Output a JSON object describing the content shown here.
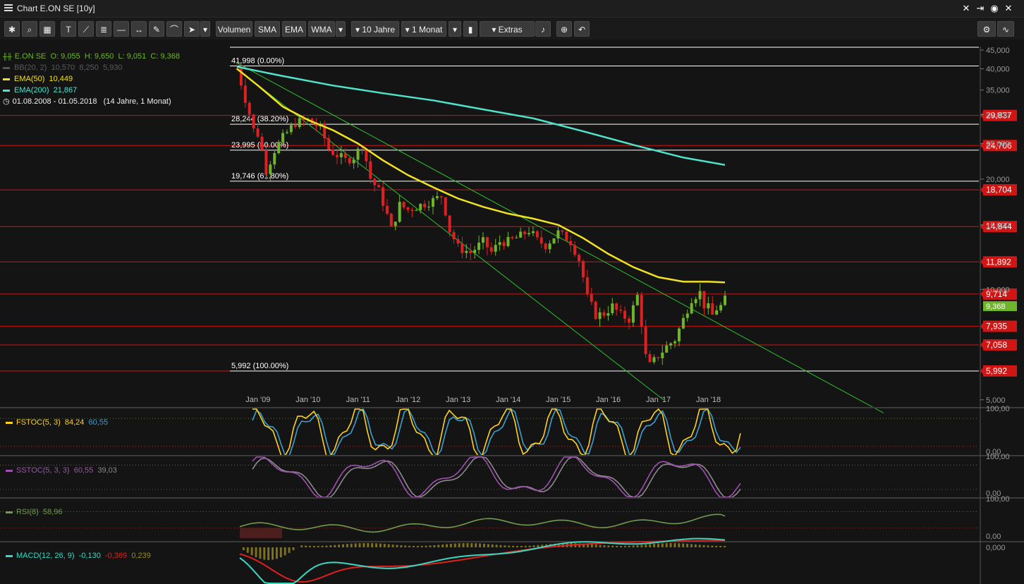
{
  "window": {
    "title": "Chart E.ON SE [10y]"
  },
  "toolbar": {
    "volumen": "Volumen",
    "sma": "SMA",
    "ema": "EMA",
    "wma": "WMA",
    "period": "10 Jahre",
    "interval": "1 Monat",
    "extras": "Extras",
    "icons": [
      "settings-icon",
      "search-icon",
      "grid-icon",
      "text-tool-icon",
      "line-tool-icon",
      "fib-tool-icon",
      "horizontal-line-icon",
      "channel-icon",
      "pen-icon",
      "arc-icon",
      "cursor-icon",
      "zoom-icon",
      "undo-icon",
      "candle-icon",
      "alarm-icon",
      "indicators-icon",
      "wave-icon"
    ]
  },
  "legend": {
    "instrument": "E.ON SE",
    "ohlc": "O: 9,055  H: 9,650  L: 9,051  C: 9,368",
    "bb": "BB(20, 2)  10,570  8,250  5,930",
    "ema50": "EMA(50)  10,449",
    "ema200": "EMA(200)  21,867",
    "range": "01.08.2008 - 01.05.2018   (14 Jahre, 1 Monat)"
  },
  "colors": {
    "bg": "#141414",
    "up": "#6fb52b",
    "down": "#e02020",
    "ema50": "#f1e222",
    "ema200": "#4fe3cc",
    "support": "#d01515",
    "channel": "#2fbf2f",
    "fib": "#ffffff",
    "fstoc_k": "#ffd21e",
    "fstoc_d": "#3aa0d0",
    "sstoc_k": "#a050b0",
    "sstoc_d": "#8a8a8a",
    "rsi": "#6f9b4a",
    "macd": "#3ed6c0",
    "signal": "#e02020"
  },
  "chart_data": [
    {
      "type": "candlestick",
      "title": "Chart E.ON SE [10y]",
      "x_labels": [
        "Jan '09",
        "Jan '10",
        "Jan '11",
        "Jan '12",
        "Jan '13",
        "Jan '14",
        "Jan '15",
        "Jan '16",
        "Jan '17",
        "Jan '18"
      ],
      "y_ticks": [
        5.0,
        10.0,
        15.0,
        20.0,
        25.0,
        30.0,
        35.0,
        40.0,
        45.0
      ],
      "y_tick_labels": [
        "5,000",
        "10,000",
        "15,000",
        "20,000",
        "25,000",
        "30,000",
        "35,000",
        "40,000",
        "45,000"
      ],
      "scale": "log",
      "y_range": [
        4.8,
        46.0
      ],
      "x_range": [
        2008.58,
        2018.33
      ],
      "close_anchors": [
        [
          2008.58,
          40.0
        ],
        [
          2008.75,
          33.0
        ],
        [
          2008.92,
          27.0
        ],
        [
          2009.0,
          26.5
        ],
        [
          2009.17,
          21.0
        ],
        [
          2009.33,
          24.0
        ],
        [
          2009.5,
          26.0
        ],
        [
          2009.75,
          28.5
        ],
        [
          2010.0,
          29.0
        ],
        [
          2010.25,
          27.5
        ],
        [
          2010.42,
          24.0
        ],
        [
          2010.75,
          22.5
        ],
        [
          2010.92,
          23.0
        ],
        [
          2011.08,
          24.8
        ],
        [
          2011.25,
          20.0
        ],
        [
          2011.42,
          18.5
        ],
        [
          2011.67,
          14.5
        ],
        [
          2011.83,
          17.0
        ],
        [
          2012.0,
          16.5
        ],
        [
          2012.25,
          17.0
        ],
        [
          2012.5,
          17.5
        ],
        [
          2012.67,
          18.0
        ],
        [
          2012.83,
          14.5
        ],
        [
          2013.0,
          13.0
        ],
        [
          2013.25,
          12.6
        ],
        [
          2013.5,
          13.5
        ],
        [
          2013.67,
          12.6
        ],
        [
          2013.83,
          13.5
        ],
        [
          2014.0,
          13.5
        ],
        [
          2014.25,
          14.0
        ],
        [
          2014.42,
          14.5
        ],
        [
          2014.58,
          13.6
        ],
        [
          2014.75,
          13.2
        ],
        [
          2015.0,
          14.3
        ],
        [
          2015.25,
          13.5
        ],
        [
          2015.42,
          12.0
        ],
        [
          2015.58,
          9.5
        ],
        [
          2015.75,
          8.5
        ],
        [
          2015.92,
          8.6
        ],
        [
          2016.08,
          9.0
        ],
        [
          2016.25,
          8.5
        ],
        [
          2016.42,
          8.3
        ],
        [
          2016.58,
          9.6
        ],
        [
          2016.75,
          6.5
        ],
        [
          2016.83,
          6.2
        ],
        [
          2016.92,
          6.4
        ],
        [
          2017.0,
          6.6
        ],
        [
          2017.17,
          7.0
        ],
        [
          2017.33,
          7.3
        ],
        [
          2017.5,
          8.3
        ],
        [
          2017.67,
          9.5
        ],
        [
          2017.83,
          9.8
        ],
        [
          2017.92,
          9.0
        ],
        [
          2018.0,
          8.9
        ],
        [
          2018.08,
          8.5
        ],
        [
          2018.17,
          8.9
        ],
        [
          2018.25,
          9.0
        ],
        [
          2018.33,
          9.37
        ]
      ],
      "ema50": [
        [
          2008.58,
          40.0
        ],
        [
          2009.0,
          36.0
        ],
        [
          2009.5,
          31.5
        ],
        [
          2010.0,
          29.0
        ],
        [
          2010.5,
          27.2
        ],
        [
          2011.0,
          25.0
        ],
        [
          2011.5,
          22.5
        ],
        [
          2012.0,
          20.5
        ],
        [
          2012.5,
          19.0
        ],
        [
          2013.0,
          17.7
        ],
        [
          2013.5,
          16.8
        ],
        [
          2014.0,
          16.1
        ],
        [
          2014.5,
          15.6
        ],
        [
          2015.0,
          15.0
        ],
        [
          2015.5,
          13.8
        ],
        [
          2016.0,
          12.5
        ],
        [
          2016.5,
          11.5
        ],
        [
          2017.0,
          10.8
        ],
        [
          2017.5,
          10.5
        ],
        [
          2018.0,
          10.5
        ],
        [
          2018.33,
          10.45
        ]
      ],
      "ema200": [
        [
          2008.58,
          40.5
        ],
        [
          2009.5,
          38.2
        ],
        [
          2010.5,
          36.0
        ],
        [
          2011.5,
          34.3
        ],
        [
          2012.5,
          32.8
        ],
        [
          2013.5,
          31.0
        ],
        [
          2014.5,
          29.3
        ],
        [
          2015.5,
          27.0
        ],
        [
          2016.5,
          24.8
        ],
        [
          2017.5,
          22.9
        ],
        [
          2018.33,
          21.87
        ]
      ],
      "fib_levels": [
        {
          "label": "41,998 (0.00%)",
          "value": 41.998
        },
        {
          "label": "28,244 (38.20%)",
          "value": 28.244
        },
        {
          "label": "23,995 (50.00%)",
          "value": 23.995
        },
        {
          "label": "19,746 (61.80%)",
          "value": 19.746
        },
        {
          "label": "5,992 (100.00%)",
          "value": 5.992
        }
      ],
      "support_levels": [
        {
          "label": "29,837",
          "value": 29.837
        },
        {
          "label": "24,706",
          "value": 24.706
        },
        {
          "label": "18,704",
          "value": 18.704
        },
        {
          "label": "14,844",
          "value": 14.844
        },
        {
          "label": "11,892",
          "value": 11.892
        },
        {
          "label": "9,714",
          "value": 9.714
        },
        {
          "label": "7,935",
          "value": 7.935
        },
        {
          "label": "7,058",
          "value": 7.058
        },
        {
          "label": "5,992",
          "value": 5.992
        }
      ],
      "last_price": {
        "label": "9,368",
        "value": 9.368
      },
      "channel_upper": [
        [
          2008.58,
          41.5
        ],
        [
          2018.33,
          9.2
        ]
      ],
      "channel_lower": [
        [
          2008.58,
          40.0
        ],
        [
          2011.5,
          16.0
        ],
        [
          2015.5,
          7.0
        ],
        [
          2017.1,
          5.0
        ]
      ],
      "channel_upper_ext": [
        [
          2018.33,
          9.2
        ],
        [
          2021.5,
          4.6
        ]
      ]
    },
    {
      "type": "line",
      "name": "FSTOC(5, 3)",
      "values_text": [
        "84,24",
        "60,55"
      ],
      "y_ticks": [
        "100,00",
        "0,00"
      ],
      "y_range": [
        0,
        100
      ]
    },
    {
      "type": "line",
      "name": "SSTOC(5, 3, 3)",
      "values_text": [
        "60,55",
        "39,03"
      ],
      "y_ticks": [
        "100,00",
        "0,00"
      ],
      "y_range": [
        0,
        100
      ]
    },
    {
      "type": "line",
      "name": "RSI(8)",
      "values_text": [
        "58,96"
      ],
      "y_ticks": [
        "100,00",
        "0,00"
      ],
      "y_range": [
        0,
        100
      ]
    },
    {
      "type": "bar",
      "name": "MACD(12, 26, 9)",
      "values_text": [
        "-0,130",
        "-0,369",
        "0,239"
      ],
      "y_ticks": [
        "0,000"
      ]
    }
  ]
}
